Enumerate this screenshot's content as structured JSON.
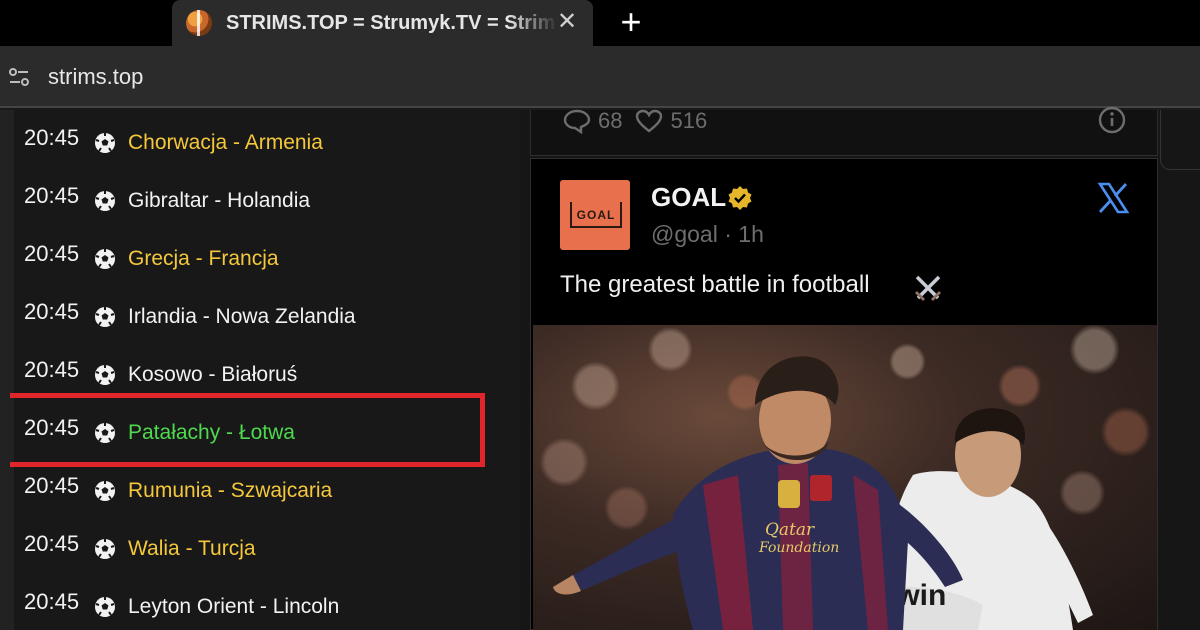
{
  "browser": {
    "tab_title": "STRIMS.TOP = Strumyk.TV = Strimy",
    "close_glyph": "✕",
    "new_tab_glyph": "+",
    "url": "strims.top"
  },
  "schedule": [
    {
      "time": "20:45",
      "match": "Chorwacja - Armenia",
      "color": "#f5c73b",
      "style": "yellow"
    },
    {
      "time": "20:45",
      "match": "Gibraltar - Holandia",
      "color": "#f2f2f2",
      "style": "white"
    },
    {
      "time": "20:45",
      "match": "Grecja - Francja",
      "color": "#f5c73b",
      "style": "yellow"
    },
    {
      "time": "20:45",
      "match": "Irlandia - Nowa Zelandia",
      "color": "#f2f2f2",
      "style": "white"
    },
    {
      "time": "20:45",
      "match": "Kosowo - Białoruś",
      "color": "#f2f2f2",
      "style": "white"
    },
    {
      "time": "20:45",
      "match": "Patałachy - Łotwa",
      "color": "#4fd94f",
      "style": "green"
    },
    {
      "time": "20:45",
      "match": "Rumunia - Szwajcaria",
      "color": "#f5c73b",
      "style": "yellow"
    },
    {
      "time": "20:45",
      "match": "Walia - Turcja",
      "color": "#f5c73b",
      "style": "yellow"
    },
    {
      "time": "20:45",
      "match": "Leyton Orient - Lincoln",
      "color": "#f2f2f2",
      "style": "white"
    }
  ],
  "previous_tweet": {
    "replies": "68",
    "likes": "516"
  },
  "tweet": {
    "display_name": "GOAL",
    "handle_time": "@goal · 1h",
    "text": "The greatest battle in football",
    "avatar_text": "GOAL",
    "accent": "#e8704c"
  },
  "icons": {
    "tab_favicon": "basketball-icon",
    "site_info": "tune-icon",
    "ball": "soccer-ball-icon",
    "reply": "comment-icon",
    "like": "heart-icon",
    "info": "info-icon",
    "verified": "verified-badge-icon",
    "platform": "x-logo-icon",
    "emoji": "crossed-swords-icon"
  }
}
